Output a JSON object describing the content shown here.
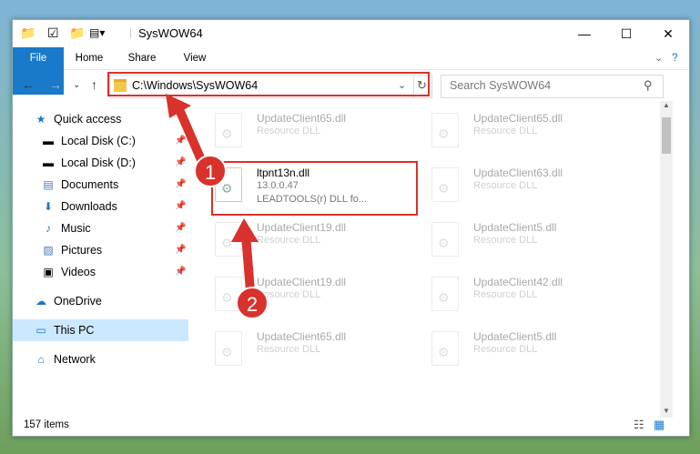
{
  "window": {
    "title": "SysWOW64"
  },
  "ribbon": {
    "tabs": [
      "File",
      "Home",
      "Share",
      "View"
    ]
  },
  "address": {
    "path": "C:\\Windows\\SysWOW64"
  },
  "search": {
    "placeholder": "Search SysWOW64"
  },
  "sidebar": {
    "items": [
      {
        "label": "Quick access"
      },
      {
        "label": "Local Disk (C:)"
      },
      {
        "label": "Local Disk (D:)"
      },
      {
        "label": "Documents"
      },
      {
        "label": "Downloads"
      },
      {
        "label": "Music"
      },
      {
        "label": "Pictures"
      },
      {
        "label": "Videos"
      },
      {
        "label": "OneDrive"
      },
      {
        "label": "This PC"
      },
      {
        "label": "Network"
      }
    ]
  },
  "files": {
    "selected": {
      "name": "ltpnt13n.dll",
      "version": "13.0.0.47",
      "desc": "LEADTOOLS(r) DLL fo..."
    },
    "left": [
      {
        "name": "UpdateClient65.dll",
        "type": "Resource DLL"
      },
      {
        "name": "UpdateClient19.dll",
        "type": "Resource DLL"
      },
      {
        "name": "UpdateClient19.dll",
        "type": "Resource DLL"
      },
      {
        "name": "UpdateClient65.dll",
        "type": "Resource DLL"
      }
    ],
    "right": [
      {
        "name": "UpdateClient65.dll",
        "type": "Resource DLL"
      },
      {
        "name": "UpdateClient63.dll",
        "type": "Resource DLL"
      },
      {
        "name": "UpdateClient5.dll",
        "type": "Resource DLL"
      },
      {
        "name": "UpdateClient42.dll",
        "type": "Resource DLL"
      },
      {
        "name": "UpdateClient5.dll",
        "type": "Resource DLL"
      }
    ]
  },
  "status": {
    "count": "157 items"
  },
  "annotations": {
    "one": "1",
    "two": "2"
  }
}
